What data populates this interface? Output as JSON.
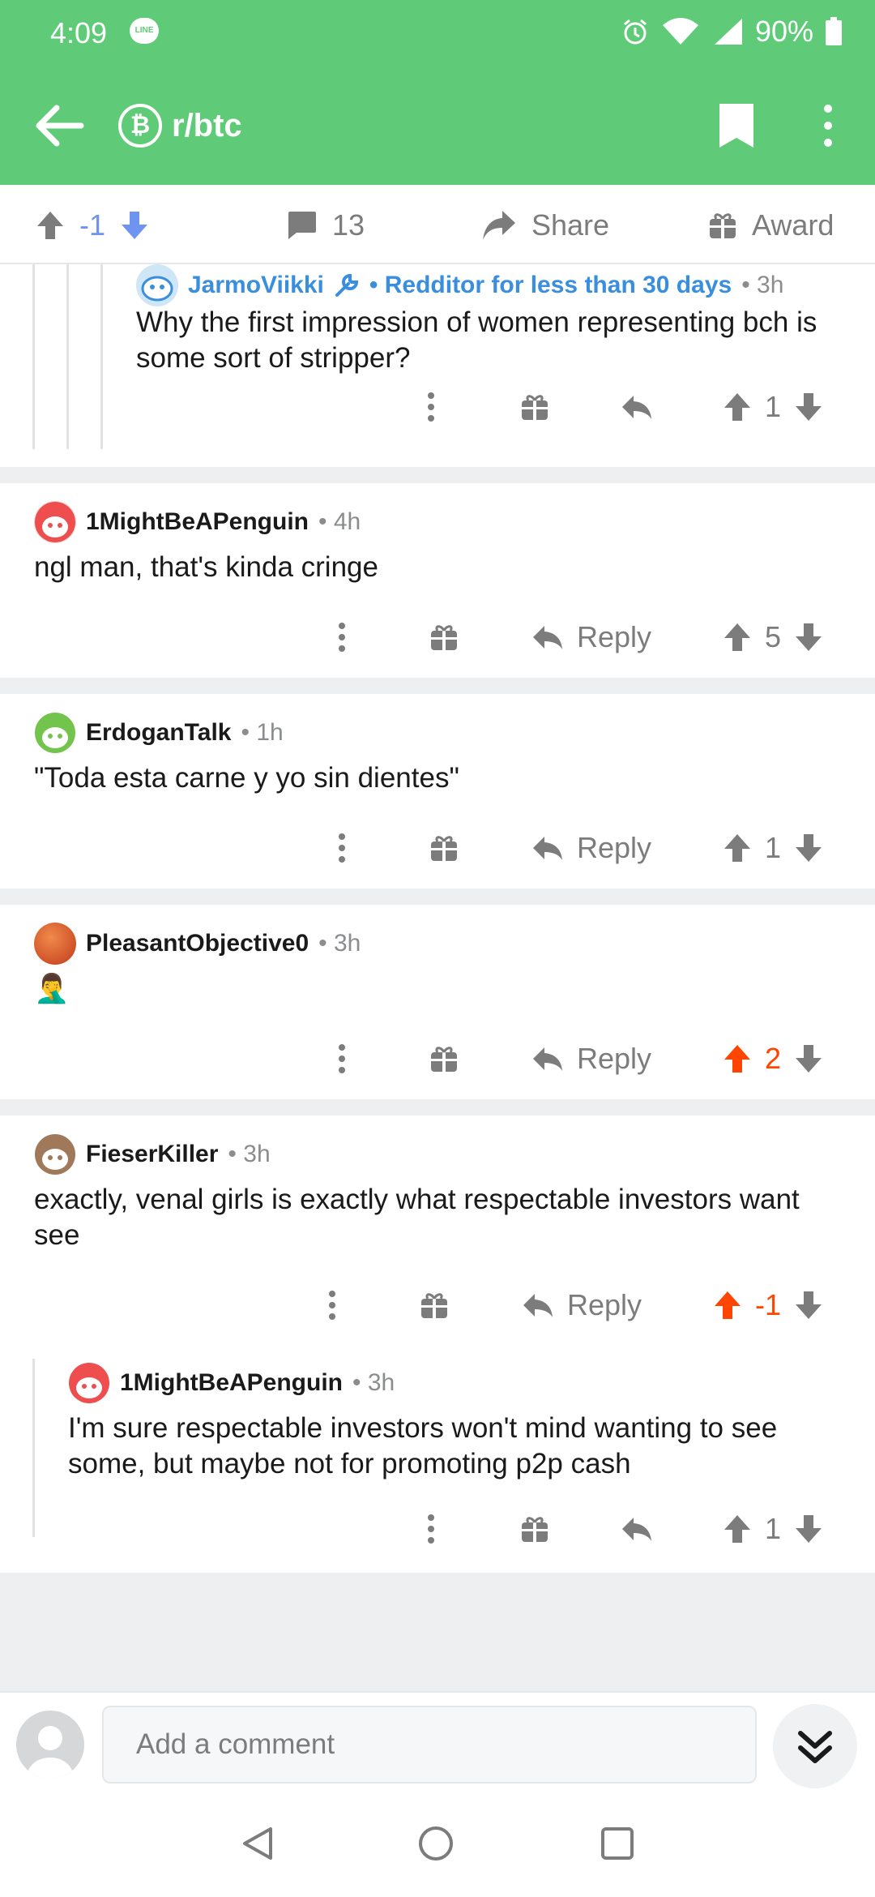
{
  "status_bar": {
    "time": "4:09",
    "line_badge": "LINE",
    "battery": "90%"
  },
  "app_bar": {
    "subreddit": "r/btc",
    "subreddit_icon": "bitcoin-icon"
  },
  "post_actions": {
    "score": "-1",
    "comments": "13",
    "share": "Share",
    "award": "Award"
  },
  "comments": [
    {
      "author": "JarmoViikki",
      "flair": "Redditor for less than 30 days",
      "age": "3h",
      "body": "Why the first impression of women representing bch is some sort of stripper?",
      "score": "1"
    },
    {
      "author": "1MightBeAPenguin",
      "age": "4h",
      "body": "ngl man, that's kinda cringe",
      "reply": "Reply",
      "score": "5"
    },
    {
      "author": "ErdoganTalk",
      "age": "1h",
      "body": "\"Toda esta carne y yo sin dientes\"",
      "reply": "Reply",
      "score": "1"
    },
    {
      "author": "PleasantObjective0",
      "age": "3h",
      "body": "🤦‍♂️",
      "reply": "Reply",
      "score": "2"
    },
    {
      "author": "FieserKiller",
      "age": "3h",
      "body": "exactly, venal girls is exactly what respectable investors want see",
      "reply": "Reply",
      "score": "-1"
    },
    {
      "author": "1MightBeAPenguin",
      "age": "3h",
      "body": "I'm sure respectable investors won't mind wanting to see some, but maybe not for promoting p2p cash",
      "score": "1"
    }
  ],
  "composer": {
    "placeholder": "Add a comment"
  },
  "colors": {
    "accent": "#5fcb78",
    "upvote": "#ff4500",
    "op_blue": "#3a8ede",
    "score_blue": "#6e93f0"
  }
}
